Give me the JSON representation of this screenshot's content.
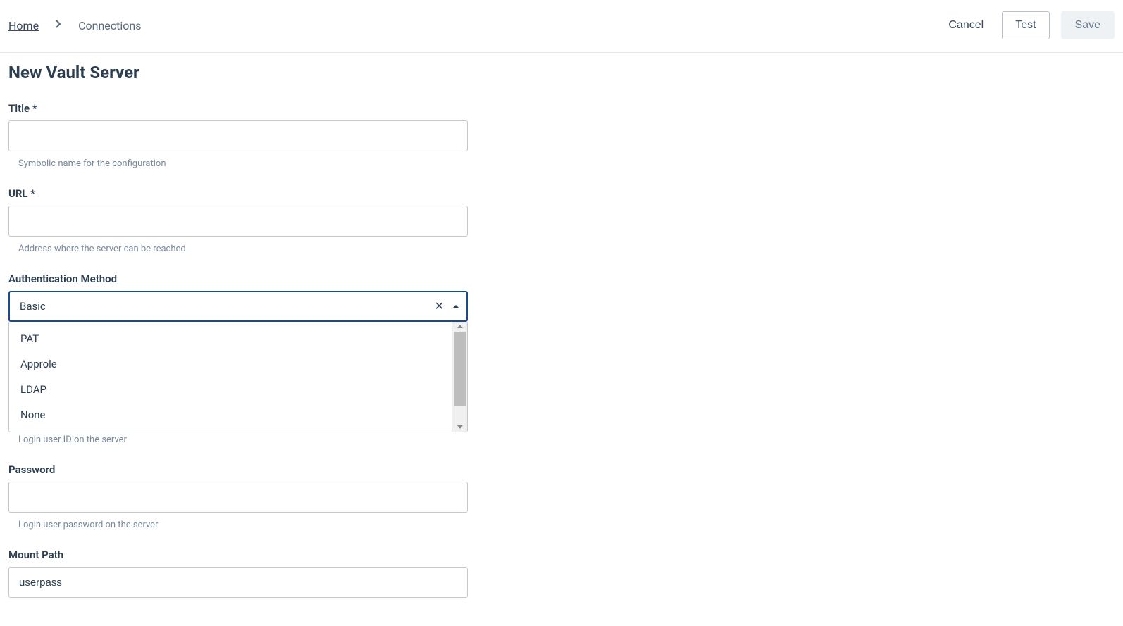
{
  "breadcrumb": {
    "home": "Home",
    "current": "Connections"
  },
  "actions": {
    "cancel": "Cancel",
    "test": "Test",
    "save": "Save"
  },
  "page": {
    "title": "New Vault Server"
  },
  "form": {
    "title": {
      "label": "Title *",
      "hint": "Symbolic name for the configuration",
      "value": ""
    },
    "url": {
      "label": "URL *",
      "hint": "Address where the server can be reached",
      "value": ""
    },
    "authMethod": {
      "label": "Authentication Method",
      "selected": "Basic",
      "options": [
        "PAT",
        "Approle",
        "LDAP",
        "None"
      ]
    },
    "userId": {
      "hint": "Login user ID on the server"
    },
    "password": {
      "label": "Password",
      "hint": "Login user password on the server",
      "value": ""
    },
    "mountPath": {
      "label": "Mount Path",
      "value": "userpass"
    }
  }
}
